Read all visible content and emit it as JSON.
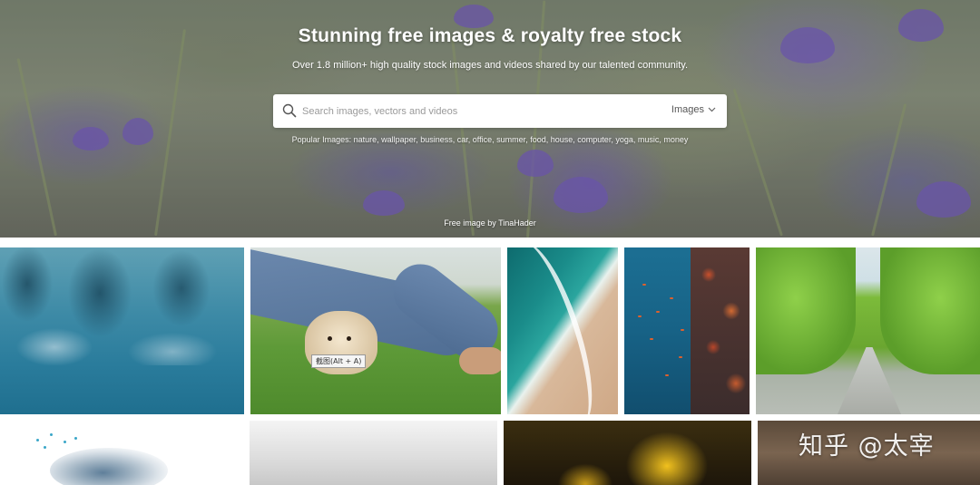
{
  "hero": {
    "title": "Stunning free images & royalty free stock",
    "subtitle": "Over 1.8 million+ high quality stock images and videos shared by our talented community.",
    "credit": "Free image by TinaHader"
  },
  "search": {
    "placeholder": "Search images, vectors and videos",
    "type_label": "Images",
    "icon": "search-icon"
  },
  "popular": {
    "label": "Popular Images:",
    "tags": [
      "nature",
      "wallpaper",
      "business",
      "car",
      "office",
      "summer",
      "food",
      "house",
      "computer",
      "yoga",
      "music",
      "money"
    ]
  },
  "grid": {
    "row1": [
      "reflection pool with palm trees",
      "puppy under legs on grass",
      "aerial beach waves",
      "coral reef with fish",
      "tree-lined road with cyclist"
    ],
    "row2": [
      "eye with paint splash",
      "misty landscape",
      "yellow flower",
      "car"
    ]
  },
  "tooltip": "截图(Alt + A)",
  "watermark": "知乎 @太宰",
  "colors": {
    "hero_text": "#ffffff",
    "search_bg": "#ffffff",
    "placeholder": "#9a9a9a"
  }
}
